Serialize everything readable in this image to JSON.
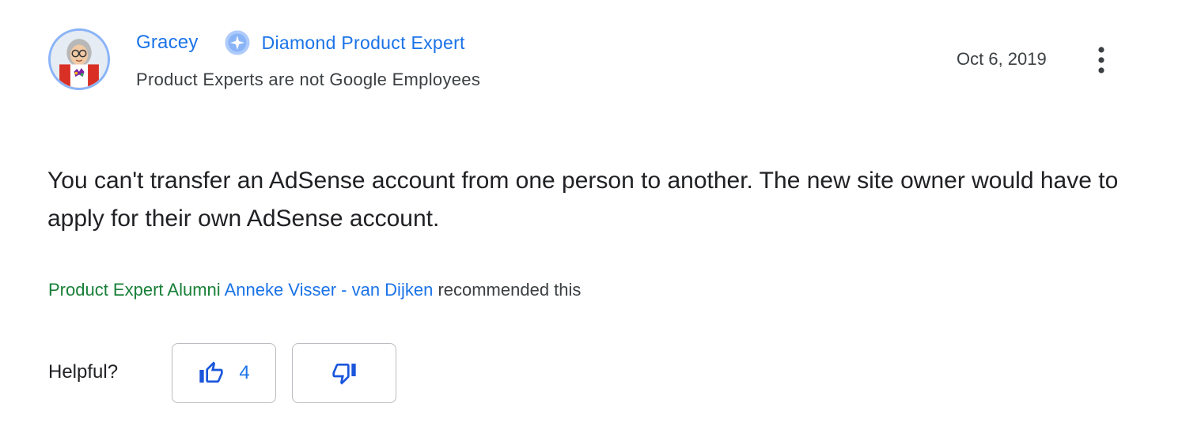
{
  "author": {
    "name": "Gracey",
    "badge": "Diamond Product Expert",
    "badge_icon": "diamond-badge-icon",
    "disclaimer": "Product Experts are not Google Employees",
    "avatar": "avatar-image"
  },
  "post": {
    "date": "Oct 6, 2019",
    "more_icon": "more-vert-icon",
    "body": "You can't transfer an AdSense account from one person to another. The new site owner would have to apply for their own AdSense account."
  },
  "recommendation": {
    "badge": "Product Expert Alumni",
    "user": "Anneke Visser - van Dijken",
    "text": "recommended this"
  },
  "feedback": {
    "label": "Helpful?",
    "upvote_icon": "thumb-up-icon",
    "upvote_count": "4",
    "downvote_icon": "thumb-down-icon"
  },
  "colors": {
    "link_blue": "#1a73e8",
    "alumni_green": "#188038",
    "avatar_ring": "#8ab4f8",
    "button_border": "#b9bcc0"
  }
}
